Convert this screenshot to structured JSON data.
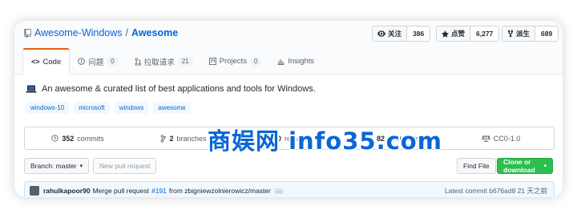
{
  "repo": {
    "owner": "Awesome-Windows",
    "separator": "/",
    "name": "Awesome"
  },
  "social": [
    {
      "label": "关注",
      "count": "386",
      "icon": "eye-icon"
    },
    {
      "label": "点赞",
      "count": "6,277",
      "icon": "star-icon"
    },
    {
      "label": "派生",
      "count": "689",
      "icon": "fork-icon"
    }
  ],
  "tabs": [
    {
      "label": "Code",
      "icon": "code-icon",
      "active": true
    },
    {
      "label": "问题",
      "count": "0",
      "icon": "issue-icon"
    },
    {
      "label": "拉取请求",
      "count": "21",
      "icon": "pull-request-icon"
    },
    {
      "label": "Projects",
      "count": "0",
      "icon": "project-icon"
    },
    {
      "label": "Insights",
      "icon": "graph-icon"
    }
  ],
  "description": "An awesome & curated list of best applications and tools for Windows.",
  "topics": [
    "windows-10",
    "microsoft",
    "windows",
    "awesome"
  ],
  "summary": [
    {
      "value": "352",
      "label": "commits",
      "icon": "history-icon"
    },
    {
      "value": "2",
      "label": "branches",
      "icon": "branch-icon"
    },
    {
      "value": "0",
      "label": "releases",
      "icon": "tag-icon"
    },
    {
      "value": "82",
      "label": "contributors",
      "icon": "people-icon"
    },
    {
      "value": "",
      "label": "CC0-1.0",
      "icon": "law-icon"
    }
  ],
  "toolbar": {
    "branch": "Branch: master",
    "new_pr": "New pull request",
    "find_file": "Find File",
    "clone": "Clone or download"
  },
  "commit": {
    "author": "rahulkapoor90",
    "message_prefix": "Merge pull request",
    "pr_link": "#191",
    "message_suffix": "from zbigniewzolnierowicz/master",
    "ellipsis": "...",
    "latest": "Latest commit b676ad8 21 天之前"
  },
  "watermark": "商娱网 info35.com",
  "colors": {
    "link": "#0366d6",
    "accent_tab": "#e36209",
    "clone_green": "#2cbe4e",
    "watermark": "#0b66d6"
  }
}
